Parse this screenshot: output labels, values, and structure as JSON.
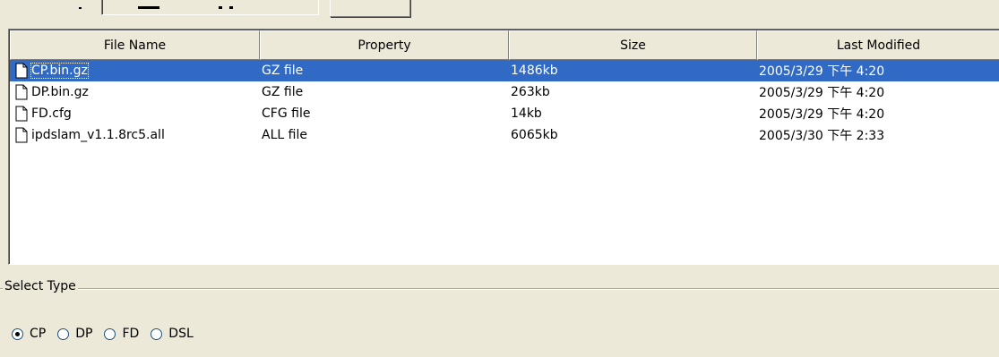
{
  "table": {
    "columns": [
      "File Name",
      "Property",
      "Size",
      "Last Modified"
    ],
    "rows": [
      {
        "name": "CP.bin.gz",
        "property": "GZ file",
        "size": "1486kb",
        "modified": "2005/3/29 下午 4:20"
      },
      {
        "name": "DP.bin.gz",
        "property": "GZ file",
        "size": "263kb",
        "modified": "2005/3/29 下午 4:20"
      },
      {
        "name": "FD.cfg",
        "property": "CFG file",
        "size": "14kb",
        "modified": "2005/3/29 下午 4:20"
      },
      {
        "name": "ipdslam_v1.1.8rc5.all",
        "property": "ALL file",
        "size": "6065kb",
        "modified": "2005/3/30 下午 2:33"
      }
    ],
    "selected_index": 0
  },
  "select_type": {
    "title": "Select Type",
    "options": [
      "CP",
      "DP",
      "FD",
      "DSL"
    ],
    "selected": "CP"
  },
  "icons": {
    "file": "file-icon"
  },
  "colors": {
    "selection": "#316ac5",
    "window_bg": "#ece9d8"
  }
}
